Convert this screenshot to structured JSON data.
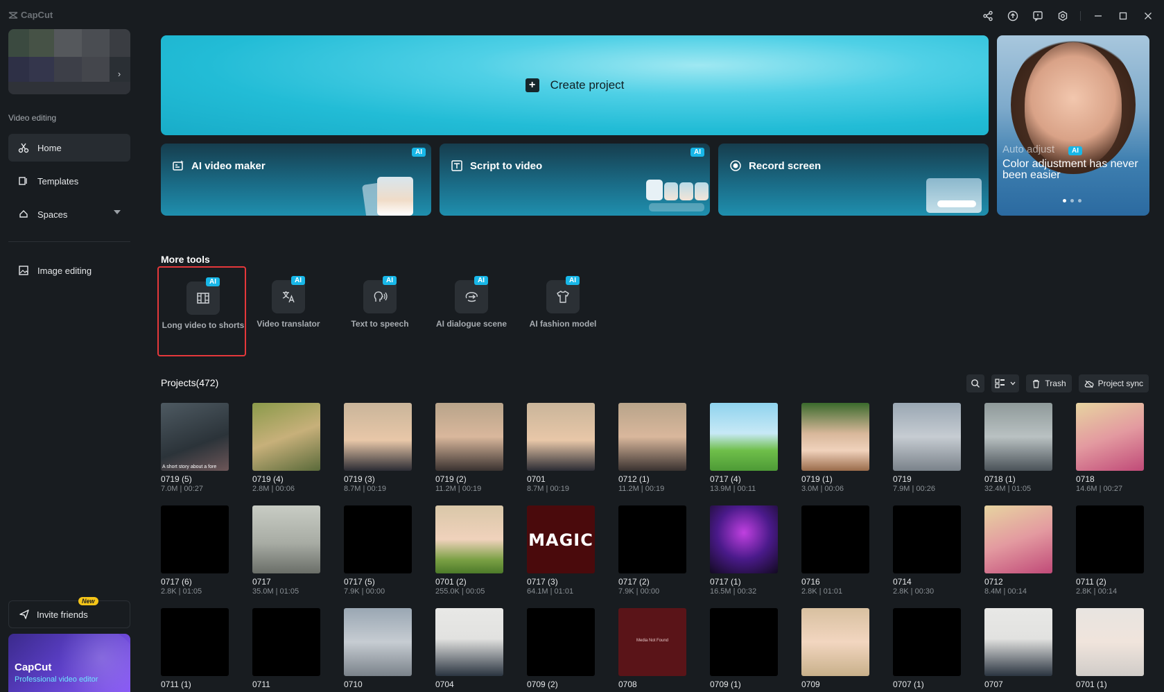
{
  "app": {
    "name": "CapCut"
  },
  "sidebar": {
    "section_label": "Video editing",
    "items": [
      {
        "label": "Home"
      },
      {
        "label": "Templates"
      },
      {
        "label": "Spaces"
      },
      {
        "label": "Image editing"
      }
    ],
    "invite": {
      "label": "Invite friends",
      "badge": "New"
    },
    "promo": {
      "title": "CapCut",
      "subtitle": "Professional video editor"
    }
  },
  "hero": {
    "create_label": "Create project",
    "tools": [
      {
        "label": "AI video maker",
        "badge": "AI"
      },
      {
        "label": "Script to video",
        "badge": "AI"
      },
      {
        "label": "Record screen"
      }
    ],
    "banner": {
      "tag": "Auto adjust",
      "badge": "AI",
      "text": "Color adjustment has never been easier"
    }
  },
  "more_tools": {
    "title": "More tools",
    "items": [
      {
        "label": "Long video to shorts",
        "badge": "AI"
      },
      {
        "label": "Video translator",
        "badge": "AI"
      },
      {
        "label": "Text to speech",
        "badge": "AI"
      },
      {
        "label": "AI dialogue scene",
        "badge": "AI"
      },
      {
        "label": "AI fashion model",
        "badge": "AI"
      }
    ]
  },
  "projects": {
    "title": "Projects(472)",
    "trash_label": "Trash",
    "sync_label": "Project sync",
    "rows": [
      [
        {
          "name": "0719 (5)",
          "meta": "7.0M | 00:27",
          "caption": "A short story about a fore"
        },
        {
          "name": "0719 (4)",
          "meta": "2.8M | 00:06"
        },
        {
          "name": "0719 (3)",
          "meta": "8.7M | 00:19"
        },
        {
          "name": "0719 (2)",
          "meta": "11.2M | 00:19"
        },
        {
          "name": "0701",
          "meta": "8.7M | 00:19"
        },
        {
          "name": "0712 (1)",
          "meta": "11.2M | 00:19"
        },
        {
          "name": "0717 (4)",
          "meta": "13.9M | 00:11"
        },
        {
          "name": "0719 (1)",
          "meta": "3.0M | 00:06"
        },
        {
          "name": "0719",
          "meta": "7.9M | 00:26"
        },
        {
          "name": "0718 (1)",
          "meta": "32.4M | 01:05"
        },
        {
          "name": "0718",
          "meta": "14.6M | 00:27"
        }
      ],
      [
        {
          "name": "0717 (6)",
          "meta": "2.8K | 01:05"
        },
        {
          "name": "0717",
          "meta": "35.0M | 01:05"
        },
        {
          "name": "0717 (5)",
          "meta": "7.9K | 00:00"
        },
        {
          "name": "0701 (2)",
          "meta": "255.0K | 00:05"
        },
        {
          "name": "0717 (3)",
          "meta": "64.1M | 01:01",
          "overlay": "MAGIC"
        },
        {
          "name": "0717 (2)",
          "meta": "7.9K | 00:00"
        },
        {
          "name": "0717 (1)",
          "meta": "16.5M | 00:32"
        },
        {
          "name": "0716",
          "meta": "2.8K | 01:01"
        },
        {
          "name": "0714",
          "meta": "2.8K | 00:30"
        },
        {
          "name": "0712",
          "meta": "8.4M | 00:14"
        },
        {
          "name": "0711 (2)",
          "meta": "2.8K | 00:14"
        }
      ],
      [
        {
          "name": "0711 (1)"
        },
        {
          "name": "0711"
        },
        {
          "name": "0710"
        },
        {
          "name": "0704"
        },
        {
          "name": "0709 (2)"
        },
        {
          "name": "0708",
          "overlay": "Media Not Found"
        },
        {
          "name": "0709 (1)"
        },
        {
          "name": "0709"
        },
        {
          "name": "0707 (1)"
        },
        {
          "name": "0707"
        },
        {
          "name": "0701 (1)"
        }
      ]
    ]
  },
  "colors": {
    "accent": "#22bcd6",
    "ai_badge": "#18b7e8",
    "highlight": "#e5383b"
  }
}
